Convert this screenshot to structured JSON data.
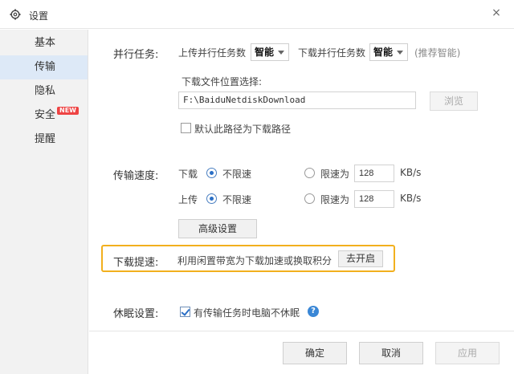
{
  "window": {
    "title": "设置",
    "icon": "gear-icon",
    "close_label": "×"
  },
  "sidebar": {
    "items": [
      {
        "label": "基本"
      },
      {
        "label": "传输",
        "active": true
      },
      {
        "label": "隐私"
      },
      {
        "label": "安全",
        "badge": "NEW"
      },
      {
        "label": "提醒"
      }
    ]
  },
  "parallel": {
    "section_label": "并行任务:",
    "upload_label": "上传并行任务数",
    "upload_value": "智能",
    "download_label": "下载并行任务数",
    "download_value": "智能",
    "recommend_note": "(推荐智能)"
  },
  "download_location": {
    "label": "下载文件位置选择:",
    "path": "F:\\BaiduNetdiskDownload",
    "browse_label": "浏览",
    "default_checkbox_label": "默认此路径为下载路径",
    "default_checked": false
  },
  "speed": {
    "section_label": "传输速度:",
    "download": {
      "label": "下载",
      "unlimited_label": "不限速",
      "limit_label": "限速为",
      "limit_value": "128",
      "unit": "KB/s",
      "selected": "unlimited"
    },
    "upload": {
      "label": "上传",
      "unlimited_label": "不限速",
      "limit_label": "限速为",
      "limit_value": "128",
      "unit": "KB/s",
      "selected": "unlimited"
    },
    "advanced_label": "高级设置"
  },
  "boost": {
    "section_label": "下载提速:",
    "description": "利用闲置带宽为下载加速或换取积分",
    "button_label": "去开启",
    "highlight_color": "#f2b01e"
  },
  "sleep": {
    "section_label": "休眠设置:",
    "checkbox_label": "有传输任务时电脑不休眠",
    "checked": true,
    "help_icon": "question-icon",
    "help_glyph": "?"
  },
  "footer": {
    "ok_label": "确定",
    "cancel_label": "取消",
    "apply_label": "应用"
  },
  "colors": {
    "accent": "#2a6fc6",
    "sidebar_active": "#dde9f7",
    "badge": "#e44444"
  }
}
